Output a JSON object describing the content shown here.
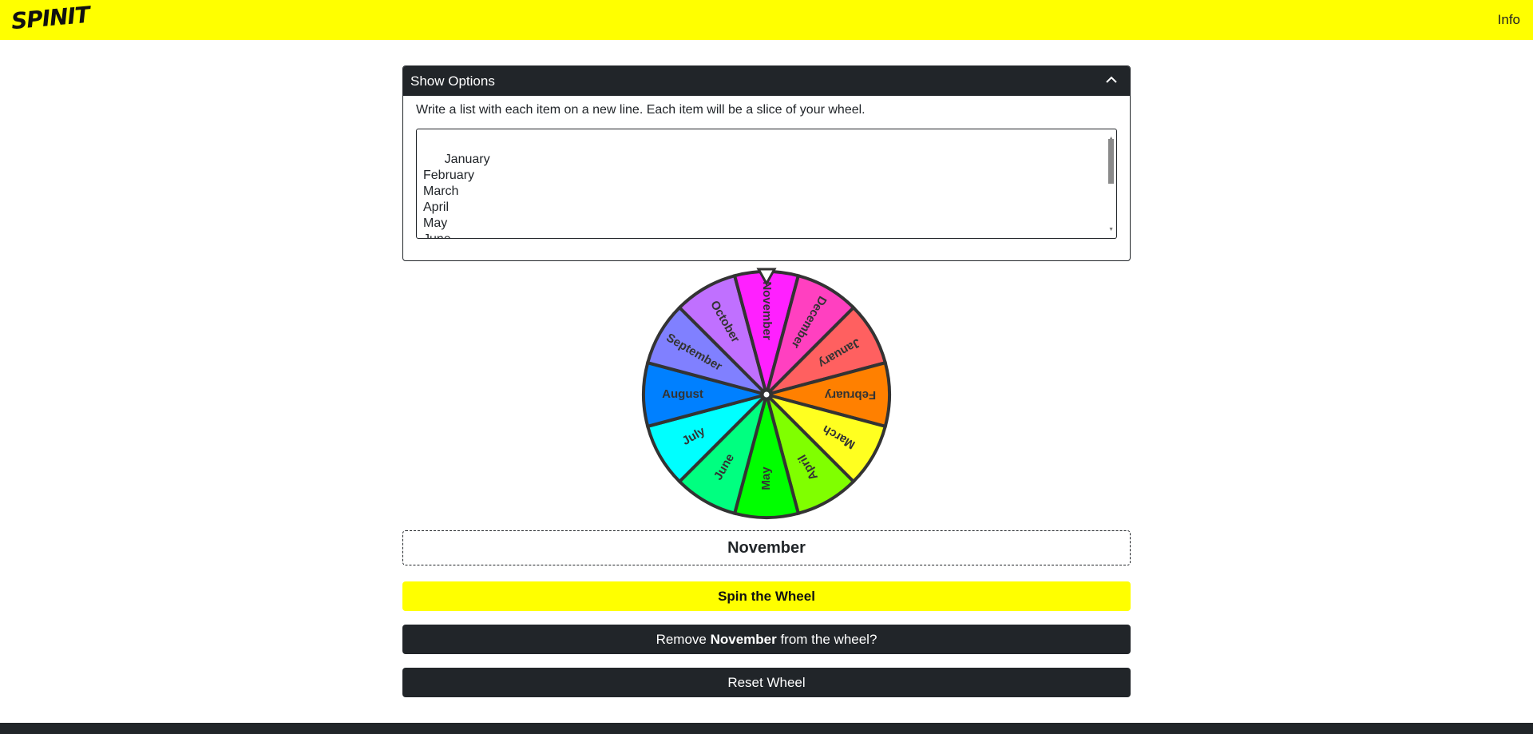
{
  "navbar": {
    "logo": "SPINIT",
    "info_label": "Info",
    "bg_color": "#ffff00"
  },
  "options": {
    "header_label": "Show Options",
    "help_text": "Write a list with each item on a new line. Each item will be a slice of your wheel.",
    "textarea_value": "January\nFebruary\nMarch\nApril\nMay\nJune\nJuly"
  },
  "wheel": {
    "pointer_at": "November",
    "slices": [
      {
        "label": "January",
        "color": "#ff6060"
      },
      {
        "label": "February",
        "color": "#ff8000"
      },
      {
        "label": "March",
        "color": "#ffff20"
      },
      {
        "label": "April",
        "color": "#80ff00"
      },
      {
        "label": "May",
        "color": "#00ff00"
      },
      {
        "label": "June",
        "color": "#00ff80"
      },
      {
        "label": "July",
        "color": "#00ffff"
      },
      {
        "label": "August",
        "color": "#0080ff"
      },
      {
        "label": "September",
        "color": "#8080ff"
      },
      {
        "label": "October",
        "color": "#c070ff"
      },
      {
        "label": "November",
        "color": "#ff20ff"
      },
      {
        "label": "December",
        "color": "#ff40c0"
      }
    ]
  },
  "result": {
    "text": "November"
  },
  "buttons": {
    "spin_label": "Spin the Wheel",
    "remove_prefix": "Remove ",
    "remove_item": "November",
    "remove_suffix": " from the wheel?",
    "reset_label": "Reset Wheel"
  }
}
